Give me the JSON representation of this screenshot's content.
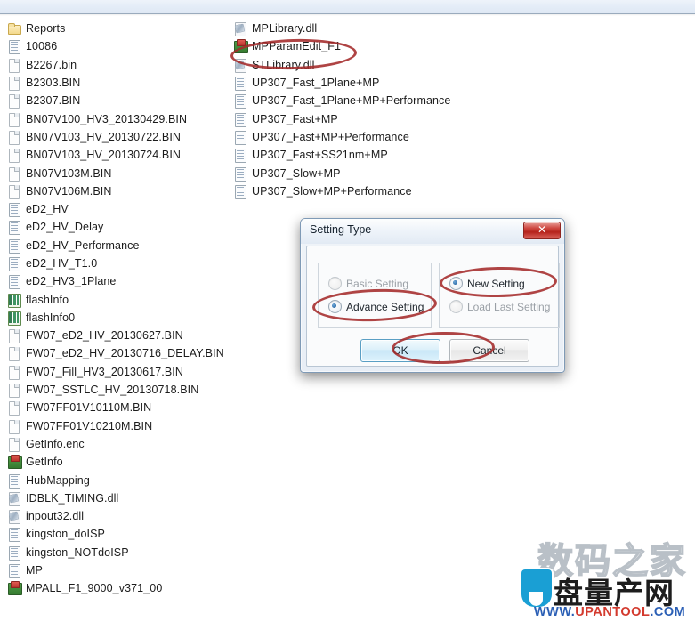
{
  "window": {
    "chrome_visible": true
  },
  "file_list": {
    "left_column": [
      {
        "name": "Reports",
        "icon": "folder-icon"
      },
      {
        "name": "10086",
        "icon": "config-file-icon"
      },
      {
        "name": "B2267.bin",
        "icon": "document-icon"
      },
      {
        "name": "B2303.BIN",
        "icon": "document-icon"
      },
      {
        "name": "B2307.BIN",
        "icon": "document-icon"
      },
      {
        "name": "BN07V100_HV3_20130429.BIN",
        "icon": "document-icon"
      },
      {
        "name": "BN07V103_HV_20130722.BIN",
        "icon": "document-icon"
      },
      {
        "name": "BN07V103_HV_20130724.BIN",
        "icon": "document-icon"
      },
      {
        "name": "BN07V103M.BIN",
        "icon": "document-icon"
      },
      {
        "name": "BN07V106M.BIN",
        "icon": "document-icon"
      },
      {
        "name": "eD2_HV",
        "icon": "config-file-icon"
      },
      {
        "name": "eD2_HV_Delay",
        "icon": "config-file-icon"
      },
      {
        "name": "eD2_HV_Performance",
        "icon": "config-file-icon"
      },
      {
        "name": "eD2_HV_T1.0",
        "icon": "config-file-icon"
      },
      {
        "name": "eD2_HV3_1Plane",
        "icon": "config-file-icon"
      },
      {
        "name": "flashInfo",
        "icon": "spreadsheet-icon"
      },
      {
        "name": "flashInfo0",
        "icon": "spreadsheet-icon"
      },
      {
        "name": "FW07_eD2_HV_20130627.BIN",
        "icon": "document-icon"
      },
      {
        "name": "FW07_eD2_HV_20130716_DELAY.BIN",
        "icon": "document-icon"
      },
      {
        "name": "FW07_Fill_HV3_20130617.BIN",
        "icon": "document-icon"
      },
      {
        "name": "FW07_SSTLC_HV_20130718.BIN",
        "icon": "document-icon"
      },
      {
        "name": "FW07FF01V10110M.BIN",
        "icon": "document-icon"
      },
      {
        "name": "FW07FF01V10210M.BIN",
        "icon": "document-icon"
      },
      {
        "name": "GetInfo.enc",
        "icon": "document-icon"
      },
      {
        "name": "GetInfo",
        "icon": "application-icon"
      },
      {
        "name": "HubMapping",
        "icon": "config-file-icon"
      },
      {
        "name": "IDBLK_TIMING.dll",
        "icon": "dll-icon"
      },
      {
        "name": "inpout32.dll",
        "icon": "dll-icon"
      },
      {
        "name": "kingston_doISP",
        "icon": "config-file-icon"
      },
      {
        "name": "kingston_NOTdoISP",
        "icon": "config-file-icon"
      },
      {
        "name": "MP",
        "icon": "config-file-icon"
      },
      {
        "name": "MPALL_F1_9000_v371_00",
        "icon": "application-icon"
      }
    ],
    "right_column": [
      {
        "name": "MPLibrary.dll",
        "icon": "dll-icon"
      },
      {
        "name": "MPParamEdit_F1",
        "icon": "application-icon"
      },
      {
        "name": "STLibrary.dll",
        "icon": "dll-icon"
      },
      {
        "name": "UP307_Fast_1Plane+MP",
        "icon": "config-file-icon"
      },
      {
        "name": "UP307_Fast_1Plane+MP+Performance",
        "icon": "config-file-icon"
      },
      {
        "name": "UP307_Fast+MP",
        "icon": "config-file-icon"
      },
      {
        "name": "UP307_Fast+MP+Performance",
        "icon": "config-file-icon"
      },
      {
        "name": "UP307_Fast+SS21nm+MP",
        "icon": "config-file-icon"
      },
      {
        "name": "UP307_Slow+MP",
        "icon": "config-file-icon"
      },
      {
        "name": "UP307_Slow+MP+Performance",
        "icon": "config-file-icon"
      }
    ]
  },
  "dialog": {
    "title": "Setting Type",
    "close_label": "✕",
    "close_icon": "close-icon",
    "left_group": {
      "options": [
        {
          "label": "Basic Setting",
          "checked": false,
          "disabled": true
        },
        {
          "label": "Advance Setting",
          "checked": true,
          "disabled": false
        }
      ]
    },
    "right_group": {
      "options": [
        {
          "label": "New Setting",
          "checked": true,
          "disabled": false
        },
        {
          "label": "Load Last Setting",
          "checked": false,
          "disabled": true
        }
      ]
    },
    "buttons": {
      "ok": "OK",
      "cancel": "Cancel"
    }
  },
  "annotations": {
    "color": "#a42a2a",
    "highlighted": [
      "MPParamEdit_F1",
      "Advance Setting",
      "New Setting",
      "OK"
    ]
  },
  "watermark": {
    "line1": "数码之家",
    "line2": "盘量产网",
    "url_www": "WWW.",
    "url_name": "UPANTOOL",
    "url_tld": ".COM",
    "shield_color": "#1a9fd4"
  }
}
